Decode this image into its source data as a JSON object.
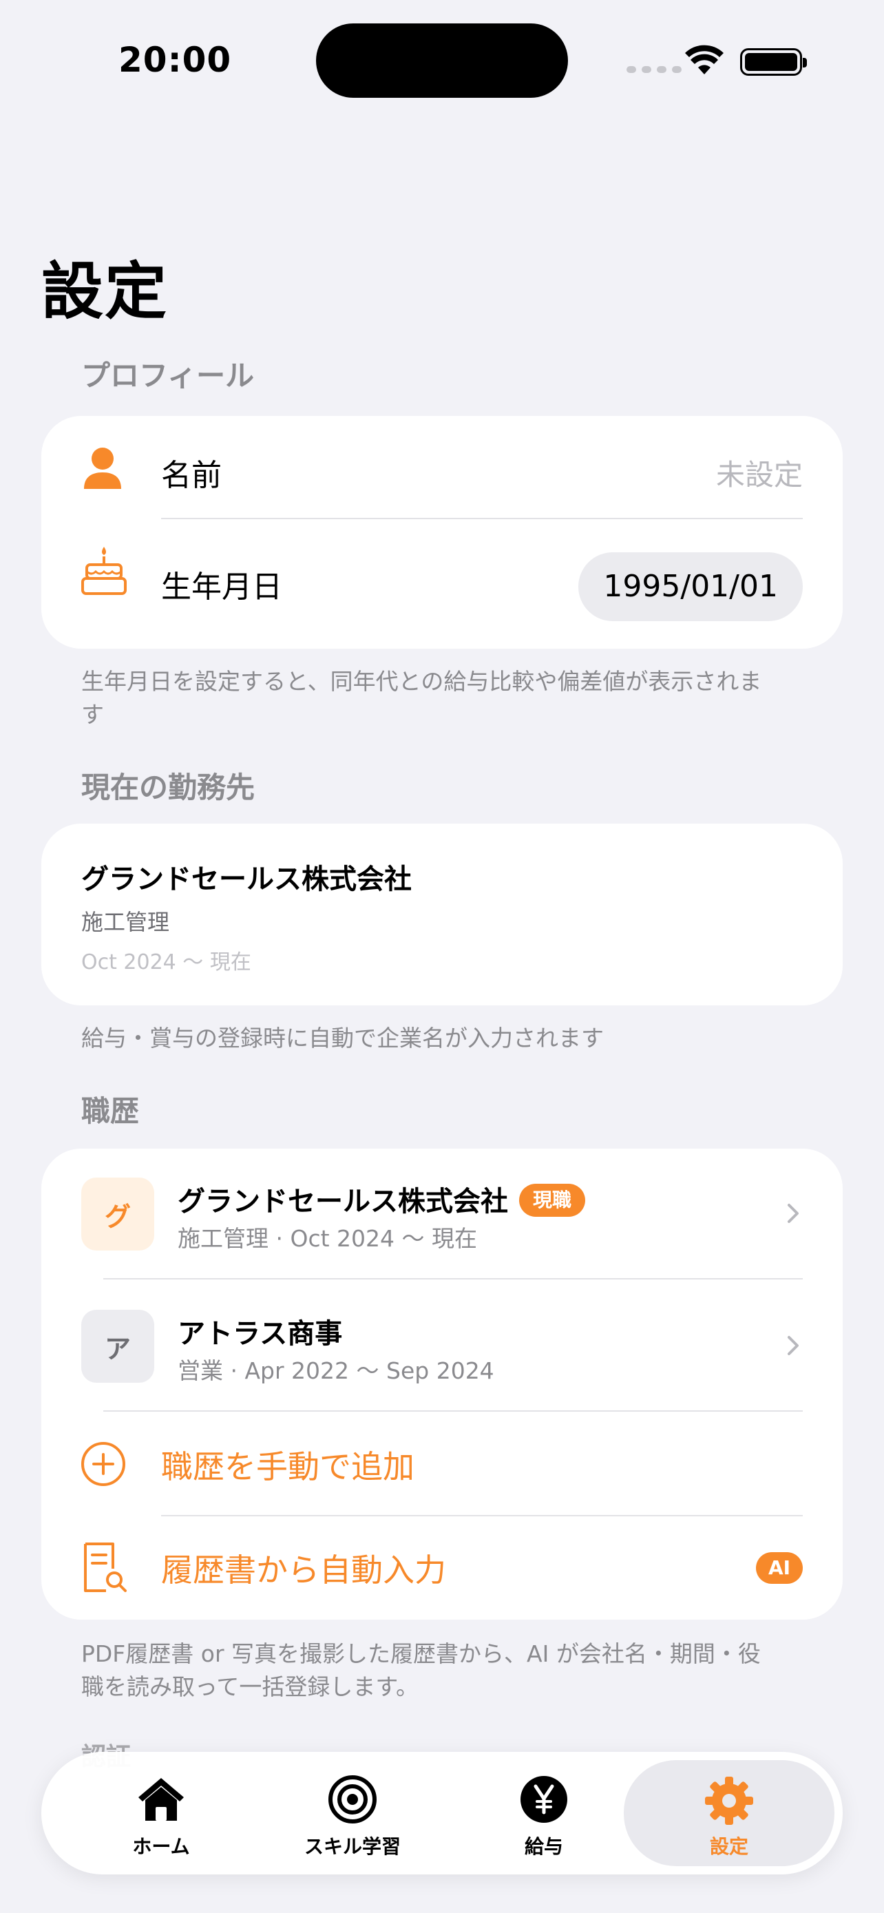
{
  "status_bar": {
    "time": "20:00"
  },
  "page": {
    "title": "設定"
  },
  "profile": {
    "header": "プロフィール",
    "name_label": "名前",
    "name_value": "未設定",
    "birthday_label": "生年月日",
    "birthday_value": "1995/01/01",
    "footnote": "生年月日を設定すると、同年代との給与比較や偏差値が表示されます"
  },
  "current_employer": {
    "header": "現在の勤務先",
    "company": "グランドセールス株式会社",
    "role": "施工管理",
    "period": "Oct 2024 〜 現在",
    "footnote": "給与・賞与の登録時に自動で企業名が入力されます"
  },
  "career": {
    "header": "職歴",
    "items": [
      {
        "initial": "グ",
        "company": "グランドセールス株式会社",
        "badge": "現職",
        "detail": "施工管理 · Oct 2024 〜 現在"
      },
      {
        "initial": "ア",
        "company": "アトラス商事",
        "badge": "",
        "detail": "営業 · Apr 2022 〜 Sep 2024"
      }
    ],
    "add_manual_label": "職歴を手動で追加",
    "resume_import_label": "履歴書から自動入力",
    "ai_badge": "AI",
    "footnote": "PDF履歴書 or 写真を撮影した履歴書から、AI が会社名・期間・役職を読み取って一括登録します。"
  },
  "next_section_peek": "認証",
  "tabbar": {
    "items": [
      {
        "label": "ホーム",
        "icon": "house-icon"
      },
      {
        "label": "スキル学習",
        "icon": "target-icon"
      },
      {
        "label": "給与",
        "icon": "yen-icon"
      },
      {
        "label": "設定",
        "icon": "gear-icon"
      }
    ],
    "active_index": 3
  },
  "colors": {
    "accent": "#f7892a",
    "background": "#f2f2f7"
  }
}
